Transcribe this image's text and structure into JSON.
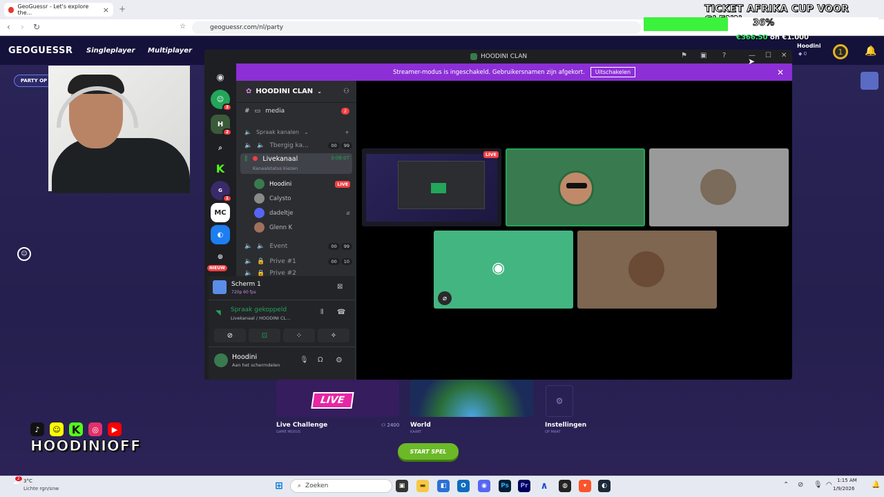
{
  "browser": {
    "tab_title": "GeoGuessr - Let's explore the...",
    "url": "geoguessr.com/nl/party"
  },
  "site": {
    "logo": "GEOGUESSR",
    "nav": [
      "Singleplayer",
      "Multiplayer"
    ],
    "party_label": "PARTY OP"
  },
  "overlay": {
    "title": "TICKET AFRIKA CUP VOOR GLENN",
    "progress_percent": 36,
    "progress_label": "36%",
    "money_current": "€366.50",
    "money_goal": "€1.000",
    "money_separator": " on "
  },
  "profile": {
    "name": "Hoodini",
    "level": "1",
    "coins": "0"
  },
  "discord": {
    "window_title": "HOODINI CLAN",
    "banner_text": "Streamer-modus is ingeschakeld. Gebruikersnamen zijn afgekort.",
    "banner_button": "Uitschakelen",
    "server_name": "HOODINI CLAN",
    "media_channel": "media",
    "media_badge": "2",
    "category": "Spraak kanalen",
    "channels": [
      {
        "name": "Tbergig ka...",
        "a": "00",
        "b": "99"
      },
      {
        "name": "Livekanaal",
        "time": "3:08:07",
        "status": "Kanaalstatus kiezen"
      },
      {
        "name": "Event",
        "a": "00",
        "b": "99"
      },
      {
        "name": "Prive #1",
        "a": "00",
        "b": "10"
      },
      {
        "name": "Prive #2"
      }
    ],
    "members": [
      {
        "name": "Hoodini",
        "live": "LIVE"
      },
      {
        "name": "Calysto"
      },
      {
        "name": "dadeltje"
      },
      {
        "name": "Glenn K"
      }
    ],
    "screen_share": {
      "title": "Scherm 1",
      "quality": "720p 60 fps"
    },
    "voice": {
      "status": "Spraak gekoppeld",
      "channel": "Livekanaal / HOODINI CL..."
    },
    "user": {
      "name": "Hoodini",
      "status": "Aan het schermdelen"
    },
    "rail_label_new": "NIEUW",
    "rail_mc": "MC",
    "stream_live": "LIVE"
  },
  "game_cards": [
    {
      "title": "Live Challenge",
      "sub": "GAME MODUS",
      "count": "2400",
      "banner": "LIVE"
    },
    {
      "title": "World",
      "sub": "KAART"
    },
    {
      "title": "Instellingen",
      "sub": "OP MAAT"
    }
  ],
  "start_button": "START SPEL",
  "social": {
    "handle": "HOODINIOFF"
  },
  "taskbar": {
    "weather_temp": "3°C",
    "weather_desc": "Lichte rgn/snw",
    "search": "Zoeken",
    "time": "1:15 AM",
    "date": "1/9/2026",
    "weather_badge": "2"
  },
  "colors": {
    "discord_purple": "#8c2fd6",
    "discord_green": "#23a55a",
    "live_red": "#f23f43",
    "progress_green": "#3cf23c"
  }
}
